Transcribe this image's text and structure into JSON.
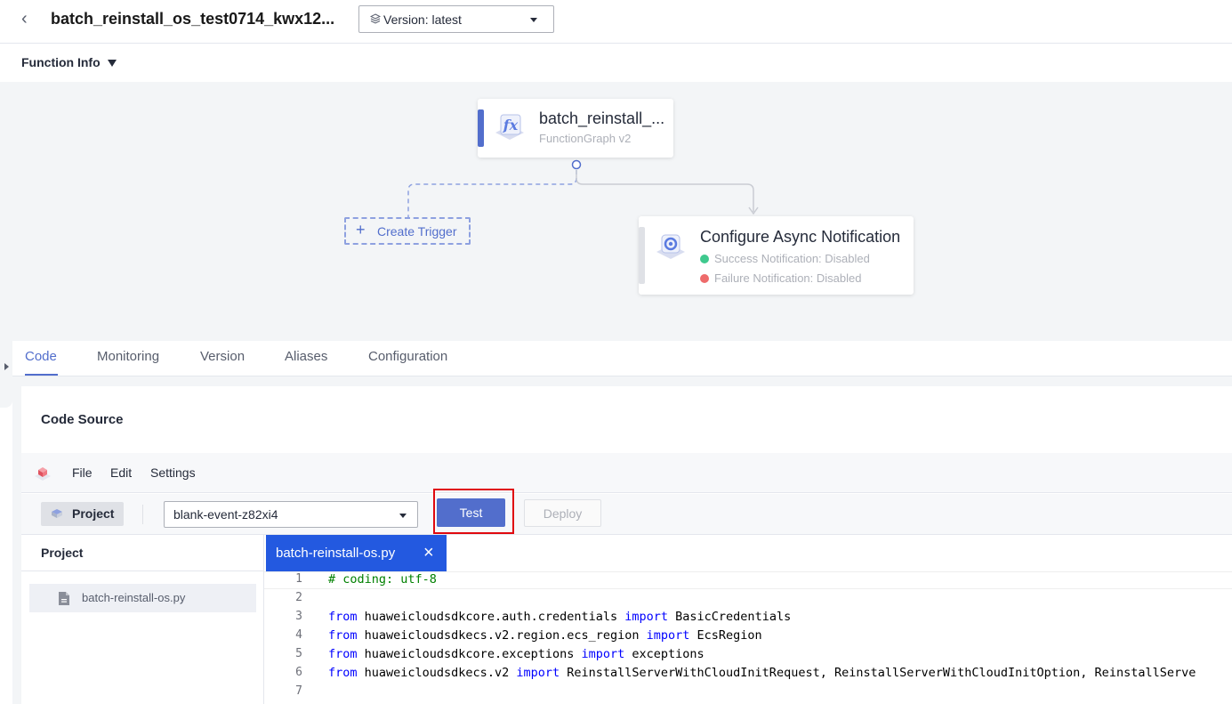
{
  "header": {
    "back_icon": "chevron-left-icon",
    "title": "batch_reinstall_os_test0714_kwx12...",
    "version_select": "Version: latest"
  },
  "function_info": {
    "label": "Function Info"
  },
  "flow": {
    "function_node": {
      "name": "batch_reinstall_...",
      "subtitle": "FunctionGraph v2"
    },
    "create_trigger": "Create Trigger",
    "async_node": {
      "name": "Configure Async Notification",
      "success": "Success Notification: Disabled",
      "failure": "Failure Notification: Disabled"
    },
    "colors": {
      "success": "#3fc98e",
      "failure": "#ee6b6b",
      "accent": "#526ecc"
    }
  },
  "tabs": [
    {
      "label": "Code",
      "active": true
    },
    {
      "label": "Monitoring"
    },
    {
      "label": "Version"
    },
    {
      "label": "Aliases"
    },
    {
      "label": "Configuration"
    }
  ],
  "code_source": {
    "title": "Code Source",
    "menu": [
      "File",
      "Edit",
      "Settings"
    ],
    "project_button": "Project",
    "event_select": "blank-event-z82xi4",
    "test_button": "Test",
    "deploy_button": "Deploy"
  },
  "project_panel": {
    "header": "Project",
    "files": [
      "batch-reinstall-os.py"
    ]
  },
  "editor": {
    "tab_label": "batch-reinstall-os.py",
    "lines": [
      {
        "n": "1",
        "parts": [
          [
            "cm",
            "# coding: utf-8"
          ]
        ]
      },
      {
        "n": "2",
        "parts": []
      },
      {
        "n": "3",
        "parts": [
          [
            "kw",
            "from"
          ],
          [
            "",
            " huaweicloudsdkcore.auth.credentials "
          ],
          [
            "kw",
            "import"
          ],
          [
            "",
            " BasicCredentials"
          ]
        ]
      },
      {
        "n": "4",
        "parts": [
          [
            "kw",
            "from"
          ],
          [
            "",
            " huaweicloudsdkecs.v2.region.ecs_region "
          ],
          [
            "kw",
            "import"
          ],
          [
            "",
            " EcsRegion"
          ]
        ]
      },
      {
        "n": "5",
        "parts": [
          [
            "kw",
            "from"
          ],
          [
            "",
            " huaweicloudsdkcore.exceptions "
          ],
          [
            "kw",
            "import"
          ],
          [
            "",
            " exceptions"
          ]
        ]
      },
      {
        "n": "6",
        "parts": [
          [
            "kw",
            "from"
          ],
          [
            "",
            " huaweicloudsdkecs.v2 "
          ],
          [
            "kw",
            "import"
          ],
          [
            "",
            " ReinstallServerWithCloudInitRequest, ReinstallServerWithCloudInitOption, ReinstallServe"
          ]
        ]
      },
      {
        "n": "7",
        "parts": []
      }
    ]
  }
}
